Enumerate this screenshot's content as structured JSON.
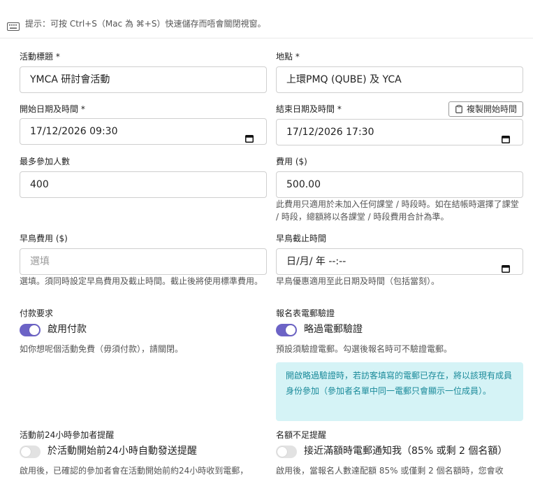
{
  "tip": {
    "icon": "keyboard-icon",
    "text": "提示：可按 Ctrl+S（Mac 為 ⌘+S）快速儲存而唔會關閉視窗。"
  },
  "fields": {
    "title": {
      "label": "活動標題 *",
      "value": "YMCA 研討會活動"
    },
    "location": {
      "label": "地點 *",
      "value": "上環PMQ (QUBE) 及 YCA"
    },
    "start": {
      "label": "開始日期及時間 *",
      "value": "17/12/2026 09:30",
      "icon": "calendar-icon"
    },
    "end": {
      "label": "結束日期及時間 *",
      "value": "17/12/2026 17:30",
      "icon": "calendar-icon",
      "copy_button": "複製開始時間",
      "copy_icon": "clipboard-icon"
    },
    "max_participants": {
      "label": "最多參加人數",
      "value": "400"
    },
    "fee": {
      "label": "費用 ($)",
      "value": "500.00",
      "hint": "此費用只適用於未加入任何課堂 / 時段時。如在結帳時選擇了課堂 / 時段，總額將以各課堂 / 時段費用合計為準。"
    },
    "early_fee": {
      "label": "早鳥費用 ($)",
      "placeholder": "選填",
      "hint": "選填。須同時設定早鳥費用及截止時間。截止後將使用標準費用。"
    },
    "early_deadline": {
      "label": "早鳥截止時間",
      "value": "日/月/ 年 --:--",
      "icon": "calendar-icon",
      "hint": "早鳥優惠適用至此日期及時間（包括當刻）。"
    }
  },
  "toggles": {
    "payment": {
      "section": "付款要求",
      "label": "啟用付款",
      "on": true,
      "hint": "如你想呢個活動免費（毋須付款），請關閉。"
    },
    "email_verify": {
      "section": "報名表電郵驗證",
      "label": "略過電郵驗證",
      "on": true,
      "hint": "預設須驗證電郵。勾選後報名時可不驗證電郵。",
      "alert": "開啟略過驗證時，若訪客填寫的電郵已存在，將以該現有成員身份參加（參加者名單中同一電郵只會顯示一位成員）。"
    },
    "reminder": {
      "section": "活動前24小時參加者提醒",
      "label": "於活動開始前24小時自動發送提醒",
      "on": false,
      "hint": "啟用後，已確認的參加者會在活動開始前約24小時收到電郵，"
    },
    "capacity": {
      "section": "名額不足提醒",
      "label": "接近滿額時電郵通知我（85% 或剩 2 個名額）",
      "on": false,
      "hint": "啟用後，當報名人數達配額 85% 或僅剩 2 個名額時，您會收"
    }
  },
  "colors": {
    "accent": "#6c63c6",
    "alert_bg": "#d5f3f6",
    "alert_text": "#1a8a9a"
  }
}
